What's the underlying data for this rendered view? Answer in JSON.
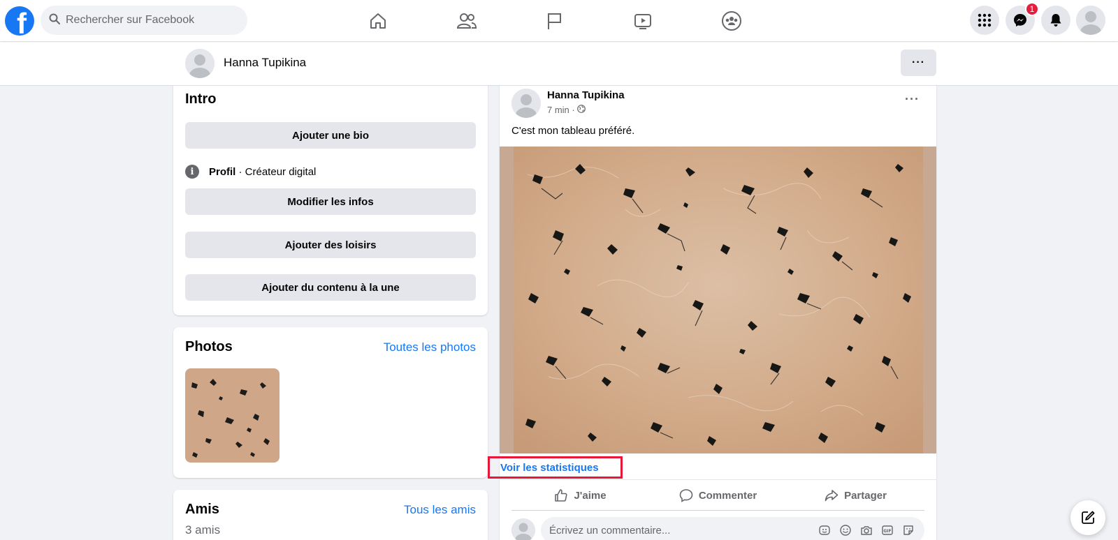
{
  "topnav": {
    "logo_letter": "f",
    "search_placeholder": "Rechercher sur Facebook",
    "messenger_badge": "1"
  },
  "profile_bar": {
    "name": "Hanna Tupikina",
    "more_label": "···"
  },
  "intro": {
    "title": "Intro",
    "add_bio": "Ajouter une bio",
    "profile_label": "Profil",
    "profile_category": " · Créateur digital",
    "edit_info": "Modifier les infos",
    "add_hobbies": "Ajouter des loisirs",
    "add_featured": "Ajouter du contenu à la une"
  },
  "photos": {
    "title": "Photos",
    "see_all": "Toutes les photos"
  },
  "friends": {
    "title": "Amis",
    "see_all": "Tous les amis",
    "count": "3 amis"
  },
  "post": {
    "author": "Hanna Tupikina",
    "time": "7 min",
    "meta_sep": " · ",
    "text": "C'est mon tableau préféré.",
    "more": "···",
    "stats_link": "Voir les statistiques",
    "actions": {
      "like": "J'aime",
      "comment": "Commenter",
      "share": "Partager"
    },
    "comment_placeholder": "Écrivez un commentaire..."
  },
  "colors": {
    "brand": "#1877f2",
    "highlight": "#e8173a",
    "painting_bg": "#c7a993"
  }
}
